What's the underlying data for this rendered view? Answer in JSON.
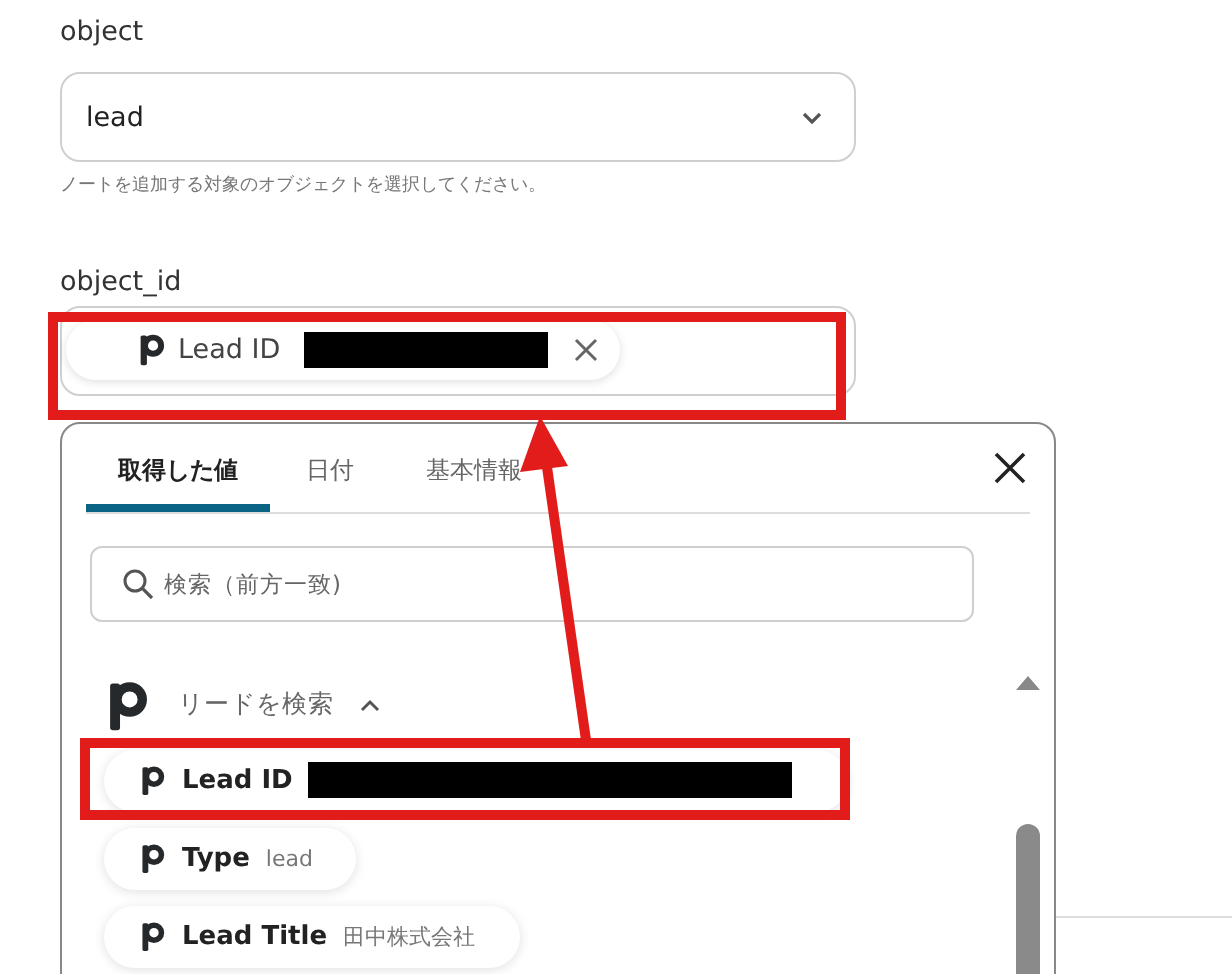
{
  "fields": [
    {
      "label": "object",
      "value": "lead",
      "hint": "ノートを追加する対象のオブジェクトを選択してください。"
    },
    {
      "label": "object_id",
      "chip": {
        "label": "Lead ID",
        "redacted": true
      }
    }
  ],
  "popup": {
    "tabs": [
      {
        "label": "取得した値",
        "selected": true
      },
      {
        "label": "日付",
        "selected": false
      },
      {
        "label": "基本情報",
        "selected": false
      }
    ],
    "search": {
      "placeholder": "検索（前方一致)"
    },
    "group": {
      "title": "リードを検索",
      "expanded": true,
      "items": [
        {
          "label": "Lead ID",
          "redacted": true
        },
        {
          "label": "Type",
          "value": "lead",
          "redacted": false
        },
        {
          "label": "Lead Title",
          "value": "田中株式会社",
          "redacted": false
        }
      ]
    }
  }
}
